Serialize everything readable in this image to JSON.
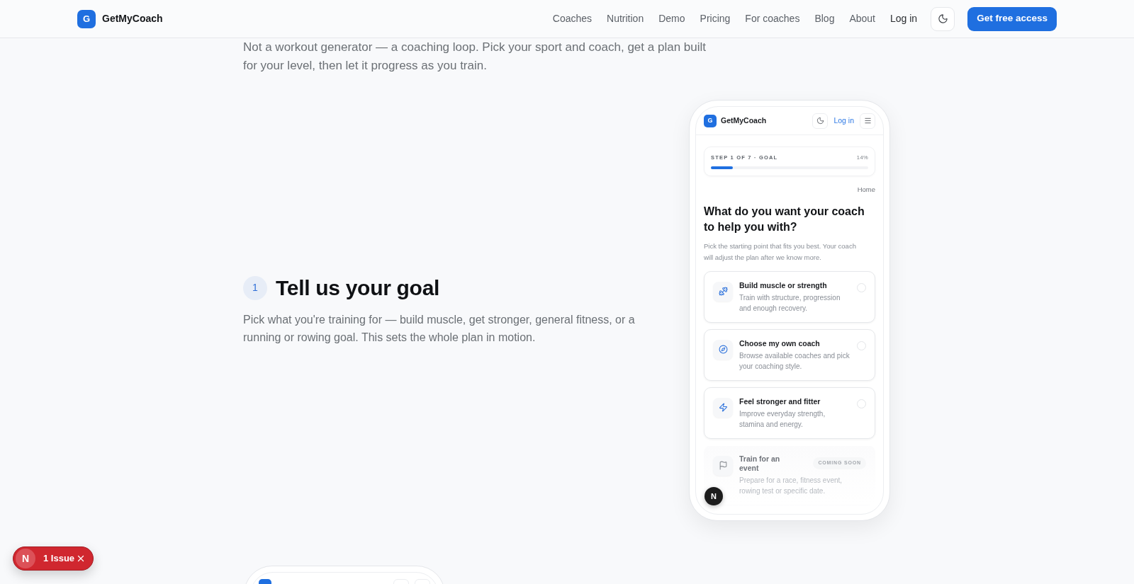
{
  "header": {
    "logo": "G",
    "brand": "GetMyCoach",
    "nav": [
      "Coaches",
      "Nutrition",
      "Demo",
      "Pricing",
      "For coaches",
      "Blog",
      "About"
    ],
    "login": "Log in",
    "cta": "Get free access"
  },
  "intro": "Not a workout generator — a coaching loop. Pick your sport and coach, get a plan built for your level, then let it progress as you train.",
  "step": {
    "number": "1",
    "title": "Tell us your goal",
    "description": "Pick what you're training for — build muscle, get stronger, general fitness, or a running or rowing goal. This sets the whole plan in motion."
  },
  "phone": {
    "header": {
      "logo": "G",
      "brand": "GetMyCoach",
      "login": "Log in"
    },
    "progress": {
      "label": "STEP 1 OF 7 · GOAL",
      "percent": "14%",
      "level": 0.14
    },
    "breadcrumb": "Home",
    "question": "What do you want your coach to help you with?",
    "hint": "Pick the starting point that fits you best. Your coach will adjust the plan after we know more.",
    "options": [
      {
        "title": "Build muscle or strength",
        "description": "Train with structure, progression and enough recovery.",
        "selected": false,
        "disabled": false
      },
      {
        "title": "Choose my own coach",
        "description": "Browse available coaches and pick your coaching style.",
        "selected": false,
        "disabled": false
      },
      {
        "title": "Feel stronger and fitter",
        "description": "Improve everyday strength, stamina and energy.",
        "selected": false,
        "disabled": false
      },
      {
        "title": "Train for an event",
        "badge": "COMING SOON",
        "description": "Prepare for a race, fitness event, rowing test or specific date.",
        "selected": false,
        "disabled": true
      }
    ],
    "dev_indicator": "N"
  },
  "issue_badge": {
    "logo": "N",
    "label": "1 Issue"
  }
}
